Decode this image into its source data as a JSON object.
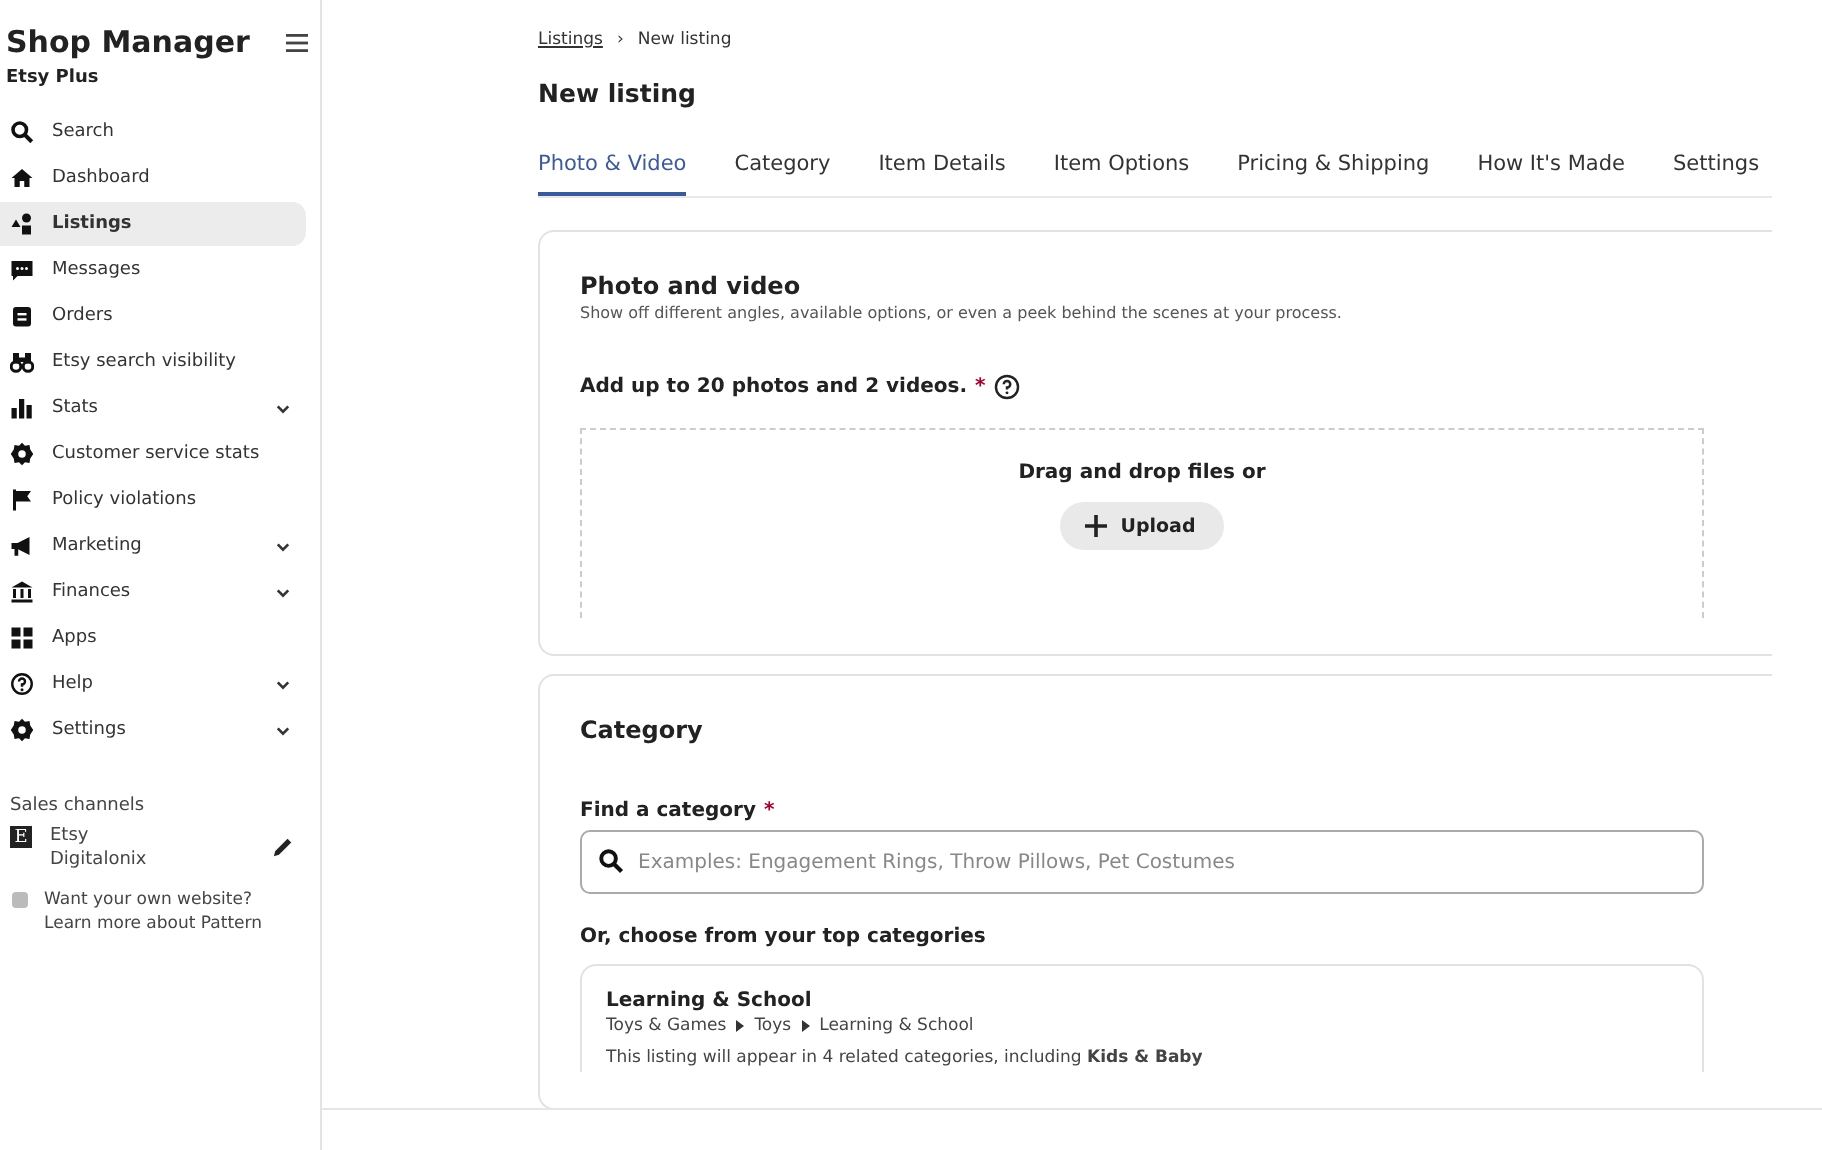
{
  "sidebar": {
    "title": "Shop Manager",
    "subtitle": "Etsy Plus",
    "items": [
      {
        "label": "Search",
        "expandable": false,
        "selected": false
      },
      {
        "label": "Dashboard",
        "expandable": false,
        "selected": false
      },
      {
        "label": "Listings",
        "expandable": false,
        "selected": true
      },
      {
        "label": "Messages",
        "expandable": false,
        "selected": false
      },
      {
        "label": "Orders",
        "expandable": false,
        "selected": false
      },
      {
        "label": "Etsy search visibility",
        "expandable": false,
        "selected": false
      },
      {
        "label": "Stats",
        "expandable": true,
        "selected": false
      },
      {
        "label": "Customer service stats",
        "expandable": false,
        "selected": false
      },
      {
        "label": "Policy violations",
        "expandable": false,
        "selected": false
      },
      {
        "label": "Marketing",
        "expandable": true,
        "selected": false
      },
      {
        "label": "Finances",
        "expandable": true,
        "selected": false
      },
      {
        "label": "Apps",
        "expandable": false,
        "selected": false
      },
      {
        "label": "Help",
        "expandable": true,
        "selected": false
      },
      {
        "label": "Settings",
        "expandable": true,
        "selected": false
      }
    ],
    "sales_channels": {
      "heading": "Sales channels",
      "channel_badge": "E",
      "channel_name": "Etsy",
      "shop_name": "Digitalonix"
    },
    "promo": {
      "line1": "Want your own website?",
      "line2": "Learn more about Pattern"
    }
  },
  "breadcrumb": {
    "link": "Listings",
    "separator": "›",
    "current": "New listing"
  },
  "page_title": "New listing",
  "tabs": [
    {
      "label": "Photo & Video",
      "selected": true
    },
    {
      "label": "Category",
      "selected": false
    },
    {
      "label": "Item Details",
      "selected": false
    },
    {
      "label": "Item Options",
      "selected": false
    },
    {
      "label": "Pricing & Shipping",
      "selected": false
    },
    {
      "label": "How It's Made",
      "selected": false
    },
    {
      "label": "Settings",
      "selected": false
    }
  ],
  "photo_section": {
    "title": "Photo and video",
    "description": "Show off different angles, available options, or even a peek behind the scenes at your process.",
    "label": "Add up to 20 photos and 2 videos.",
    "required_mark": "*",
    "dropzone_text": "Drag and drop files or",
    "upload_button": "Upload"
  },
  "category_section": {
    "title": "Category",
    "find_label": "Find a category",
    "required_mark": "*",
    "search_placeholder": "Examples: Engagement Rings, Throw Pillows, Pet Costumes",
    "top_heading": "Or, choose from your top categories",
    "suggestion": {
      "title": "Learning & School",
      "path": [
        "Toys & Games",
        "Toys",
        "Learning & School"
      ],
      "note": "This listing will appear in 4 related categories, including **Kids & Baby**"
    }
  }
}
